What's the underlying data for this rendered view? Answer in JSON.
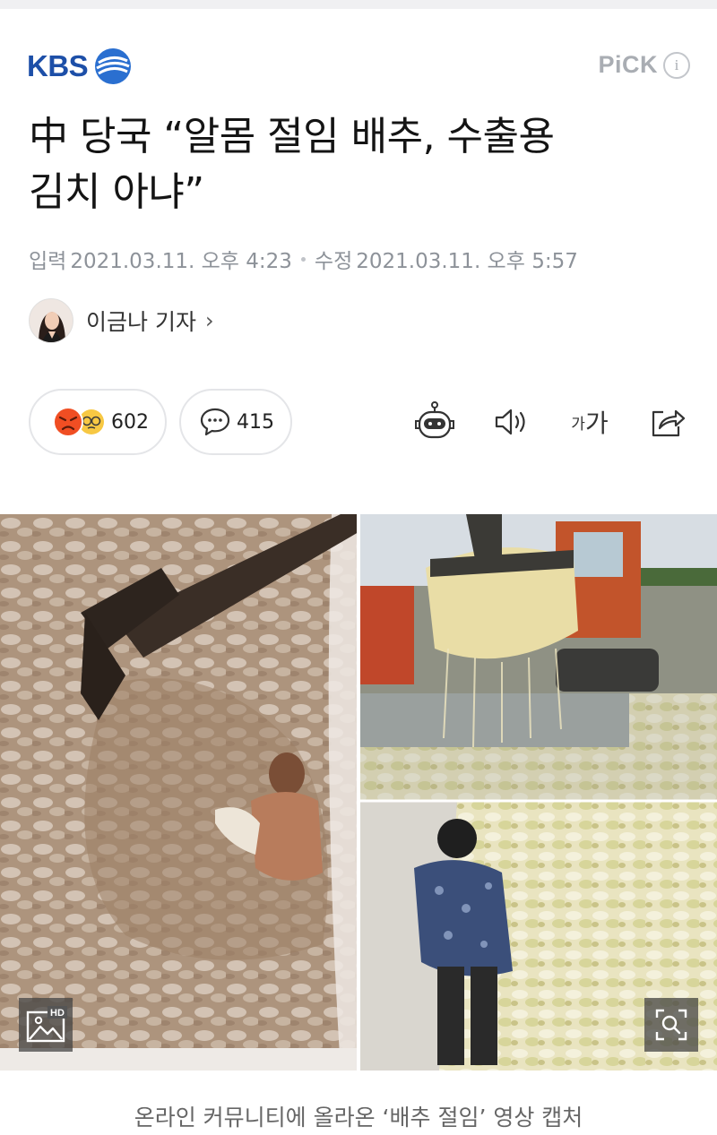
{
  "brand": {
    "name": "KBS",
    "color": "#1d4fa8"
  },
  "pick": {
    "label": "PiCK",
    "info_icon": "info-icon",
    "info_glyph": "i"
  },
  "article": {
    "headline_line1": "中 당국 “알몸 절임 배추, 수출용",
    "headline_line2": "김치 아냐”",
    "input_label": "입력",
    "input_time": "2021.03.11. 오후 4:23",
    "edit_label": "수정",
    "edit_time": "2021.03.11. 오후 5:57",
    "reporter": "이금나 기자",
    "reporter_chevron": "›"
  },
  "actions": {
    "reaction_count": "602",
    "comment_count": "415",
    "font_small": "가",
    "font_big": "가",
    "icons": [
      "robot-icon",
      "speaker-icon",
      "font-size-icon",
      "share-icon"
    ]
  },
  "photo": {
    "hd_label": "HD",
    "caption": "온라인 커뮤니티에 올라온 ‘배추 절임’ 영상 캡처"
  }
}
